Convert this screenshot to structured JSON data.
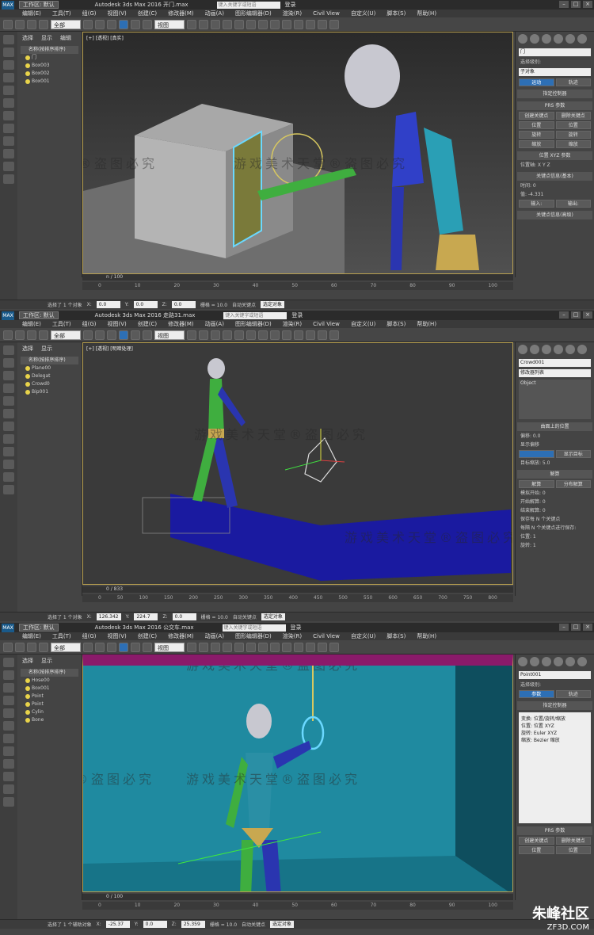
{
  "colors": {
    "accent": "#2d6fb5",
    "title_bar": "#2b2b2b",
    "viewport_border": "#b8a050",
    "panel": "#444444"
  },
  "common": {
    "login": "登录",
    "search_placeholder": "键入关键字或短语",
    "menu": [
      "编辑(E)",
      "工具(T)",
      "组(G)",
      "视图(V)",
      "创建(C)",
      "修改器(M)",
      "动画(A)",
      "图形编辑器(D)",
      "渲染(R)",
      "Civil View",
      "自定义(U)",
      "脚本(S)",
      "帮助(H)"
    ],
    "scene_tabs": [
      "选择",
      "显示",
      "编辑"
    ],
    "scene_header": "名称(按排序排序)",
    "toolbar_filter": "全部",
    "toolbar_view": "视图",
    "workspace": "工作区: 默认",
    "watermark_main": "游戏美术天堂®盗图必究",
    "watermark_short": "®盗图必究"
  },
  "panels": [
    {
      "app_title": "Autodesk 3ds Max 2016    开门.max",
      "viewport_label": "[+] [透视] [真实]",
      "scene_items": [
        "门",
        "Box003",
        "Box002",
        "Box001"
      ],
      "timeline_frame": "n / 100",
      "ruler_ticks": [
        "0",
        "10",
        "20",
        "30",
        "40",
        "50",
        "60",
        "70",
        "80",
        "90",
        "100"
      ],
      "status_text": "选择了 1 个对象",
      "coord_x": "0.0",
      "coord_y": "0.0",
      "coord_z": "0.0",
      "grid": "栅格 = 10.0",
      "autokey": "自动关键点",
      "selset": "选定对象",
      "right_field": "门",
      "right_labels": [
        "选择级别:",
        "子对象",
        "运动",
        "轨迹",
        "指定控制器",
        "PRS 参数",
        "创建关键点",
        "删除关键点",
        "位置",
        "位置",
        "旋转",
        "旋转",
        "缩放",
        "缩放",
        "位置 XYZ 参数",
        "位置轴: X Y Z",
        "关键点信息(基本)",
        "时间: 0",
        "值: -4.331",
        "输入:",
        "输出:",
        "关键点信息(高级)"
      ]
    },
    {
      "app_title": "Autodesk 3ds Max 2016    走路31.max",
      "viewport_label": "[+] [透视] [明暗处理]",
      "scene_items": [
        "Plane00",
        "Delegat",
        "Crowd0",
        "Bip001"
      ],
      "timeline_frame": "0 / 833",
      "ruler_ticks": [
        "0",
        "50",
        "100",
        "150",
        "200",
        "250",
        "300",
        "350",
        "400",
        "450",
        "500",
        "550",
        "600",
        "650",
        "700",
        "750",
        "800"
      ],
      "status_text": "选择了 1 个对象",
      "coord_x": "126.342",
      "coord_y": "224.7",
      "coord_z": "0.0",
      "grid": "栅格 = 10.0",
      "autokey": "自动关键点",
      "selset": "选定对象",
      "right_field": "Crowd001",
      "right_labels": [
        "修改器列表",
        "Object",
        "曲面上的位置",
        "偏移: 0.0",
        "显示偏移",
        "显示目标",
        "目标缩放: 5.0",
        "解算",
        "解算",
        "分布解算",
        "模拟开始: 0",
        "开始解算: 0",
        "结束解算: 0",
        "保存每 N 个关键点",
        "每隔 N 个关键点进行保存:",
        "位置: 1",
        "旋转: 1"
      ]
    },
    {
      "app_title": "Autodesk 3ds Max 2016    公交车.max",
      "viewport_label": "[+] [透视] [明暗处理]",
      "scene_items": [
        "Hose00",
        "Box001",
        "Point",
        "Point",
        "Cylin",
        "Bone"
      ],
      "timeline_frame": "0 / 100",
      "ruler_ticks": [
        "0",
        "10",
        "20",
        "30",
        "40",
        "50",
        "60",
        "70",
        "80",
        "90",
        "100"
      ],
      "status_text": "选择了 1 个辅助对象",
      "coord_x": "-25.37",
      "coord_y": "0.0",
      "coord_z": "25.359",
      "grid": "栅格 = 10.0",
      "autokey": "自动关键点",
      "selset": "选定对象",
      "right_field": "Point001",
      "right_labels": [
        "选择级别:",
        "参数",
        "轨迹",
        "指定控制器",
        "变换: 位置/旋转/缩放",
        "位置: 位置 XYZ",
        "旋转: Euler XYZ",
        "缩放: Bezier 缩放",
        "PRS 参数",
        "创建关键点",
        "删除关键点",
        "位置",
        "位置"
      ]
    }
  ],
  "site_watermark": {
    "name": "朱峰社区",
    "url": "ZF3D.COM"
  }
}
